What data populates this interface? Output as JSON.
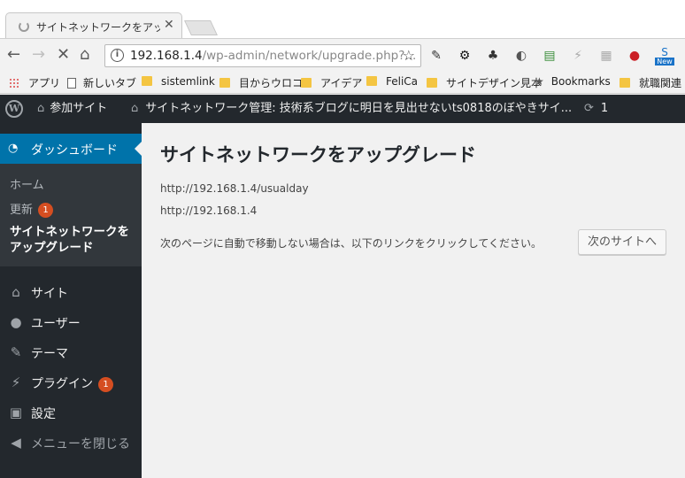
{
  "browser": {
    "tab_title": "サイトネットワークをアップグレ",
    "url_host": "192.168.1.4",
    "url_path": "/wp-admin/network/upgrade.php?...",
    "new_badge": "New"
  },
  "bookmarks": [
    {
      "label": "アプリ",
      "icon": "apps-icon"
    },
    {
      "label": "新しいタブ",
      "icon": "page-icon"
    },
    {
      "label": "sistemlink",
      "icon": "folder-icon"
    },
    {
      "label": "目からウロコ",
      "icon": "folder-icon"
    },
    {
      "label": "アイデア",
      "icon": "folder-icon"
    },
    {
      "label": "FeliCa",
      "icon": "folder-icon"
    },
    {
      "label": "サイトデザイン見本",
      "icon": "folder-icon"
    },
    {
      "label": "Bookmarks",
      "icon": "star-icon"
    },
    {
      "label": "就職関連",
      "icon": "folder-icon"
    }
  ],
  "adminbar": {
    "my_sites": "参加サイト",
    "network_admin": "サイトネットワーク管理: 技術系ブログに明日を見出せないts0818のぼやきサイ...",
    "updates_count": "1"
  },
  "sidebar": {
    "dashboard": "ダッシュボード",
    "submenu": {
      "home": "ホーム",
      "updates": "更新",
      "updates_count": "1",
      "upgrade_network": "サイトネットワークを\nアップグレード"
    },
    "items": [
      {
        "label": "サイト",
        "icon": "sites-icon"
      },
      {
        "label": "ユーザー",
        "icon": "users-icon"
      },
      {
        "label": "テーマ",
        "icon": "themes-icon"
      },
      {
        "label": "プラグイン",
        "icon": "plugins-icon",
        "badge": "1"
      },
      {
        "label": "設定",
        "icon": "settings-icon"
      },
      {
        "label": "メニューを閉じる",
        "icon": "collapse-icon"
      }
    ]
  },
  "main": {
    "title": "サイトネットワークをアップグレード",
    "site_urls": [
      "http://192.168.1.4/usualday",
      "http://192.168.1.4"
    ],
    "notice": "次のページに自動で移動しない場合は、以下のリンクをクリックしてください。",
    "next_button": "次のサイトへ"
  },
  "colors": {
    "adminbar_bg": "#23282d",
    "active_menu": "#0073aa",
    "badge": "#d54e21",
    "content_bg": "#f1f1f1"
  }
}
